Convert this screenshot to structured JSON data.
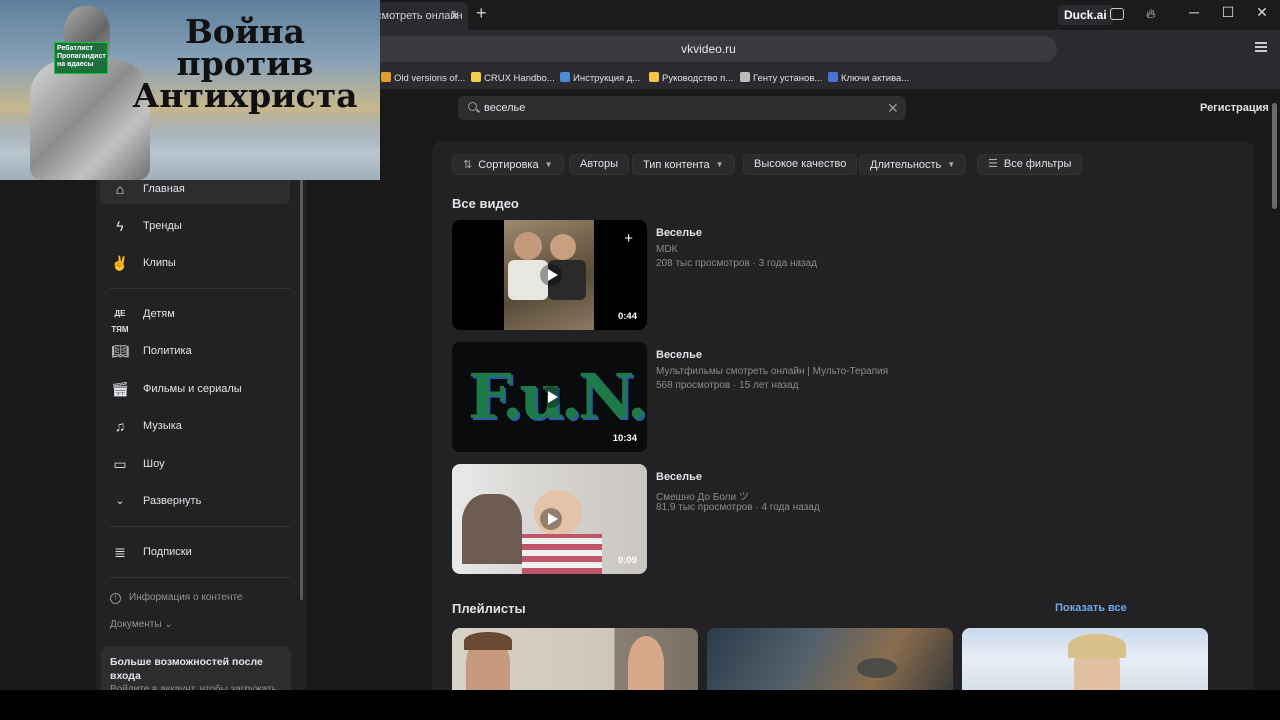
{
  "browser": {
    "tab_title": "смотреть онлайн",
    "address": "vkvideo.ru",
    "duck_label": "Duck.ai",
    "bookmarks": [
      {
        "label": "Old versions of...",
        "icon": "folder-icon",
        "color": "#e0a030"
      },
      {
        "label": "CRUX Handbo...",
        "icon": "star-icon",
        "color": "#f2d04a"
      },
      {
        "label": "Инструкция д...",
        "icon": "globe-icon",
        "color": "#4a8bd8"
      },
      {
        "label": "Руководство п...",
        "icon": "bulb-icon",
        "color": "#f6c543"
      },
      {
        "label": "Генту установ...",
        "icon": "page-icon",
        "color": "#bbbbbb"
      },
      {
        "label": "Ключи актива...",
        "icon": "help-icon",
        "color": "#4a73d8"
      }
    ]
  },
  "overlay": {
    "title": "Война против Антихриста",
    "sign_text": "Ребатлист Пропагандист на вдаесы"
  },
  "header": {
    "search_value": "веселье",
    "register_label": "Регистрация"
  },
  "sidebar": {
    "items": [
      {
        "label": "Главная",
        "icon": "home-icon"
      },
      {
        "label": "Тренды",
        "icon": "bolt-icon"
      },
      {
        "label": "Клипы",
        "icon": "clips-icon"
      },
      {
        "label": "Детям",
        "icon": "kids-icon"
      },
      {
        "label": "Политика",
        "icon": "book-icon"
      },
      {
        "label": "Фильмы и сериалы",
        "icon": "clapper-icon"
      },
      {
        "label": "Музыка",
        "icon": "music-icon"
      },
      {
        "label": "Шоу",
        "icon": "tv-icon"
      },
      {
        "label": "Развернуть",
        "icon": "chevron-down-icon"
      },
      {
        "label": "Подписки",
        "icon": "subscriptions-icon"
      }
    ],
    "info_label": "Информация о контенте",
    "docs_label": "Документы",
    "promo_title": "Больше возможностей после входа",
    "promo_sub": "Войдите в аккаунт, чтобы загружать"
  },
  "filters": [
    {
      "label": "Сортировка",
      "chevron": true,
      "icon": "sort-icon"
    },
    {
      "label": "Авторы",
      "chevron": false
    },
    {
      "label": "Тип контента",
      "chevron": true
    },
    {
      "label": "Высокое качество",
      "chevron": false
    },
    {
      "label": "Длительность",
      "chevron": true
    },
    {
      "label": "Все фильтры",
      "chevron": false,
      "icon": "filter-icon"
    }
  ],
  "main": {
    "all_videos_title": "Все видео",
    "videos": [
      {
        "title": "Веселье",
        "channel": "MDK",
        "meta": "208 тыс просмотров · 3 года назад",
        "duration": "0:44"
      },
      {
        "title": "Веселье",
        "channel": "Мультфильмы смотреть онлайн | Мульто-Терапия",
        "meta": "568 просмотров · 15 лет назад",
        "duration": "10:34"
      },
      {
        "title": "Веселье",
        "channel": "Смешно До Боли ツ",
        "meta": "81,9 тыс просмотров · 4 года назад",
        "duration": "0:09"
      }
    ],
    "playlists_title": "Плейлисты",
    "show_all_label": "Показать все",
    "thumb2_text": "F.u.N."
  }
}
